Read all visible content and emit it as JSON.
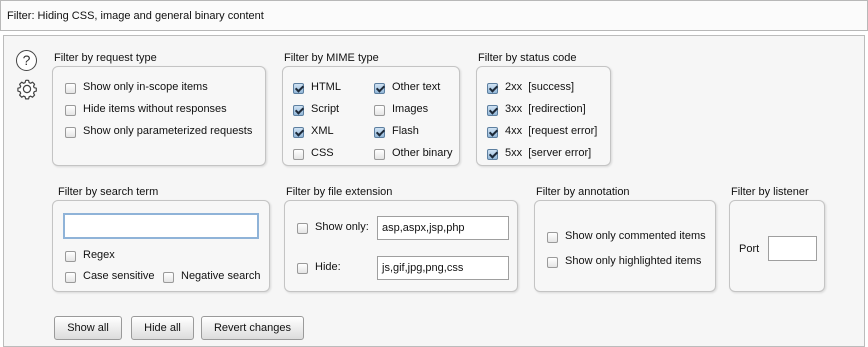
{
  "filter_bar": {
    "text": "Filter: Hiding CSS, image and general binary content"
  },
  "icons": {
    "help": "?",
    "settings": "gear-icon"
  },
  "request_type": {
    "title": "Filter by request type",
    "items": [
      {
        "label": "Show only in-scope items",
        "checked": false
      },
      {
        "label": "Hide items without responses",
        "checked": false
      },
      {
        "label": "Show only parameterized requests",
        "checked": false
      }
    ]
  },
  "mime_type": {
    "title": "Filter by MIME type",
    "col1": [
      {
        "label": "HTML",
        "checked": true
      },
      {
        "label": "Script",
        "checked": true
      },
      {
        "label": "XML",
        "checked": true
      },
      {
        "label": "CSS",
        "checked": false
      }
    ],
    "col2": [
      {
        "label": "Other text",
        "checked": true
      },
      {
        "label": "Images",
        "checked": false
      },
      {
        "label": "Flash",
        "checked": true
      },
      {
        "label": "Other binary",
        "checked": false
      }
    ]
  },
  "status_code": {
    "title": "Filter by status code",
    "items": [
      {
        "label": "2xx  [success]",
        "checked": true
      },
      {
        "label": "3xx  [redirection]",
        "checked": true
      },
      {
        "label": "4xx  [request error]",
        "checked": true
      },
      {
        "label": "5xx  [server error]",
        "checked": true
      }
    ]
  },
  "search_term": {
    "title": "Filter by search term",
    "value": "",
    "regex": {
      "label": "Regex",
      "checked": false
    },
    "case_sensitive": {
      "label": "Case sensitive",
      "checked": false
    },
    "negative": {
      "label": "Negative search",
      "checked": false
    }
  },
  "file_extension": {
    "title": "Filter by file extension",
    "show_only": {
      "label": "Show only:",
      "checked": false,
      "value": "asp,aspx,jsp,php"
    },
    "hide": {
      "label": "Hide:",
      "checked": false,
      "value": "js,gif,jpg,png,css"
    }
  },
  "annotation": {
    "title": "Filter by annotation",
    "commented": {
      "label": "Show only commented items",
      "checked": false
    },
    "highlighted": {
      "label": "Show only highlighted items",
      "checked": false
    }
  },
  "listener": {
    "title": "Filter by listener",
    "port_label": "Port",
    "port_value": ""
  },
  "buttons": {
    "show_all": "Show all",
    "hide_all": "Hide all",
    "revert": "Revert changes"
  }
}
